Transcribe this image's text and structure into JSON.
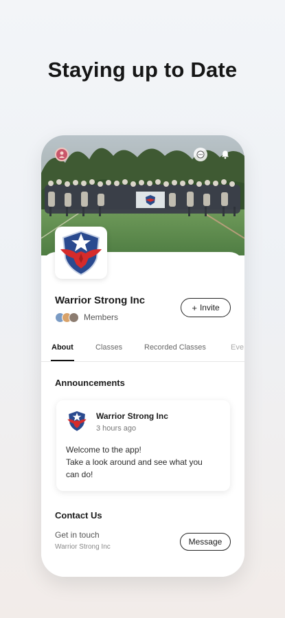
{
  "promo": {
    "headline": "Staying up to Date"
  },
  "header_icons": [
    "profile-avatar",
    "chat-icon",
    "bell-icon"
  ],
  "group": {
    "name": "Warrior Strong Inc",
    "members_label": "Members",
    "invite_label": "Invite",
    "invite_icon": "plus-icon"
  },
  "tabs": [
    {
      "label": "About",
      "active": true
    },
    {
      "label": "Classes",
      "active": false
    },
    {
      "label": "Recorded Classes",
      "active": false
    },
    {
      "label": "Eve",
      "active": false
    }
  ],
  "announcements": {
    "title": "Announcements",
    "post": {
      "author": "Warrior Strong Inc",
      "time": "3 hours ago",
      "line1": "Welcome to the app!",
      "line2": "Take a look around and see what you",
      "line3": "can do!"
    }
  },
  "contact": {
    "title": "Contact Us",
    "line1": "Get in touch",
    "line2": "Warrior Strong Inc",
    "message_label": "Message"
  },
  "colors": {
    "accent_red": "#d62b2b",
    "shield_blue": "#2a4a8f",
    "text_dark": "#1a1a1a"
  }
}
